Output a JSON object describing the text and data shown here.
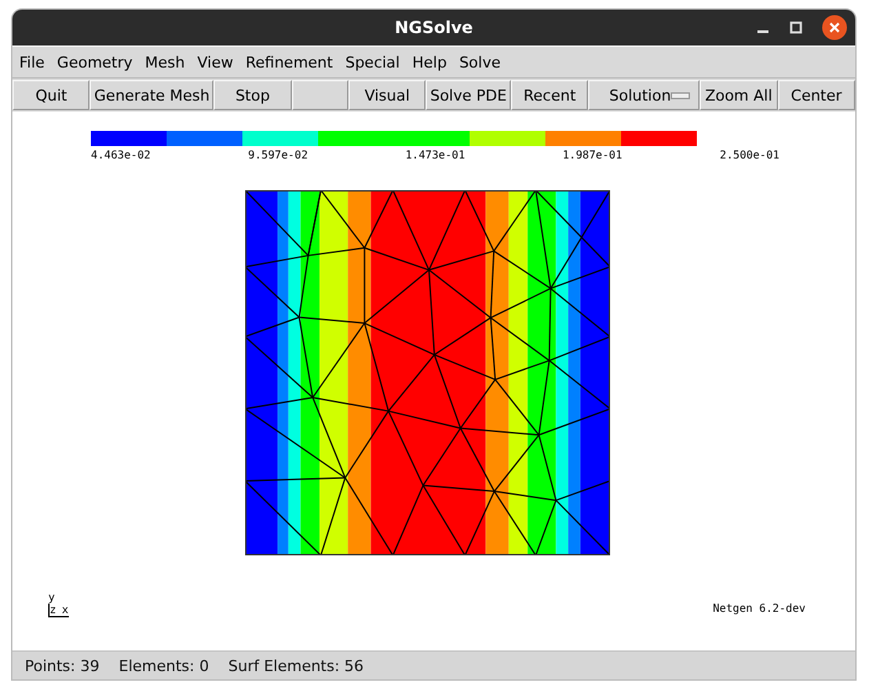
{
  "window": {
    "title": "NGSolve"
  },
  "menu": [
    {
      "label": "File"
    },
    {
      "label": "Geometry"
    },
    {
      "label": "Mesh"
    },
    {
      "label": "View"
    },
    {
      "label": "Refinement"
    },
    {
      "label": "Special"
    },
    {
      "label": "Help"
    },
    {
      "label": "Solve"
    }
  ],
  "toolbar": [
    {
      "kind": "button",
      "label": "Quit"
    },
    {
      "kind": "button",
      "label": "Generate Mesh"
    },
    {
      "kind": "button",
      "label": "Stop"
    },
    {
      "kind": "blank"
    },
    {
      "kind": "button",
      "label": "Visual"
    },
    {
      "kind": "button",
      "label": "Solve PDE"
    },
    {
      "kind": "button",
      "label": "Recent"
    },
    {
      "kind": "dropdown",
      "label": "Solution"
    },
    {
      "kind": "button",
      "label": "Zoom All"
    },
    {
      "kind": "button",
      "label": "Center"
    }
  ],
  "colorbar": {
    "segments": [
      {
        "color": "#0000ff"
      },
      {
        "color": "#0060ff"
      },
      {
        "color": "#00ffcc"
      },
      {
        "color": "#00ff00"
      },
      {
        "color": "#00ff00"
      },
      {
        "color": "#b0ff00"
      },
      {
        "color": "#ff8000"
      },
      {
        "color": "#ff0000"
      }
    ],
    "labels": [
      "4.463e-02",
      "9.597e-02",
      "1.473e-01",
      "1.987e-01",
      "2.500e-01"
    ]
  },
  "axes": {
    "y": "y",
    "z": "z",
    "x": "x"
  },
  "version": "Netgen 6.2-dev",
  "status_bar": [
    "Points: 39",
    "Elements: 0",
    "Surf Elements: 56"
  ]
}
